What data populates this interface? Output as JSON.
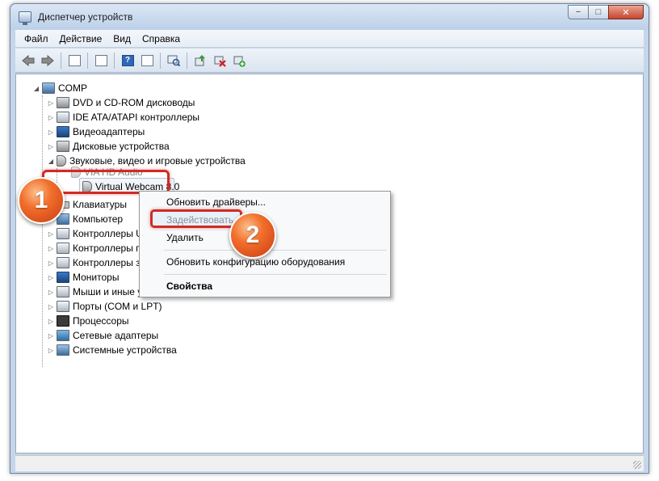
{
  "window": {
    "title": "Диспетчер устройств",
    "caption_min": "−",
    "caption_max": "□",
    "caption_close": "✕"
  },
  "menu": [
    "Файл",
    "Действие",
    "Вид",
    "Справка"
  ],
  "toolbar": {
    "help_glyph": "?"
  },
  "tree": {
    "root": "COMP",
    "items": [
      {
        "label": "DVD и CD-ROM дисководы",
        "icon": "disk-icon",
        "expander": "▷"
      },
      {
        "label": "IDE ATA/ATAPI контроллеры",
        "icon": "controller-icon",
        "expander": "▷"
      },
      {
        "label": "Видеоадаптеры",
        "icon": "monitor-icon",
        "expander": "▷"
      },
      {
        "label": "Дисковые устройства",
        "icon": "disk-icon",
        "expander": "▷"
      },
      {
        "label": "Звуковые, видео и игровые устройства",
        "icon": "speaker-icon",
        "expander": "◢"
      },
      {
        "label": "VIA HD Audio",
        "icon": "speaker-icon",
        "expander": ""
      },
      {
        "label": "Virtual Webcam 8.0",
        "icon": "speaker-icon",
        "expander": ""
      },
      {
        "label": "Клавиатуры",
        "icon": "keyboard-icon",
        "expander": "▷"
      },
      {
        "label": "Компьютер",
        "icon": "computer-icon",
        "expander": "▷"
      },
      {
        "label": "Контроллеры U",
        "icon": "usb-icon",
        "expander": "▷"
      },
      {
        "label": "Контроллеры ги",
        "icon": "controller-icon",
        "expander": "▷"
      },
      {
        "label": "Контроллеры за",
        "icon": "controller-icon",
        "expander": "▷"
      },
      {
        "label": "Мониторы",
        "icon": "monitor-icon",
        "expander": "▷"
      },
      {
        "label": "Мыши и иные у",
        "icon": "mouse-icon",
        "expander": "▷"
      },
      {
        "label": "Порты (COM и LPT)",
        "icon": "port-icon",
        "expander": "▷"
      },
      {
        "label": "Процессоры",
        "icon": "chip-icon",
        "expander": "▷"
      },
      {
        "label": "Сетевые адаптеры",
        "icon": "network-icon",
        "expander": "▷"
      },
      {
        "label": "Системные устройства",
        "icon": "computer-icon",
        "expander": "▷"
      }
    ]
  },
  "context_menu": {
    "items": [
      {
        "label": "Обновить драйверы...",
        "bold": false
      },
      {
        "label": "Задействовать",
        "bold": false
      },
      {
        "label": "Удалить",
        "bold": false
      },
      {
        "label": "Обновить конфигурацию оборудования",
        "bold": false
      },
      {
        "label": "Свойства",
        "bold": true
      }
    ]
  },
  "badges": [
    "1",
    "2"
  ],
  "colors": {
    "accent_red": "#cf2b26",
    "badge_orange": "#f26f2c"
  }
}
